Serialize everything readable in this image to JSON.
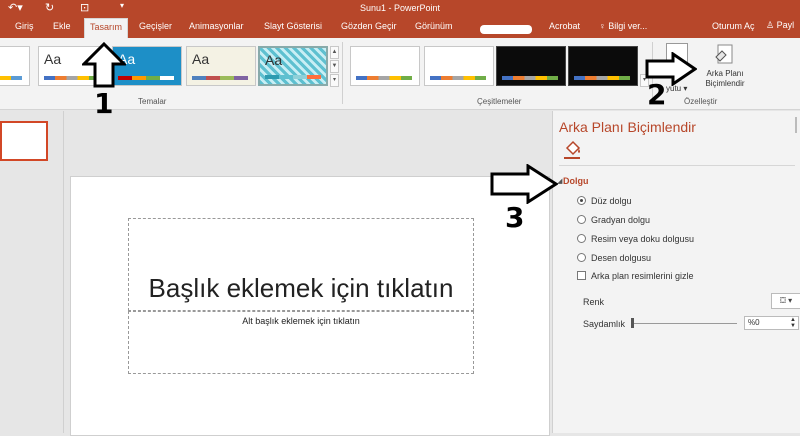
{
  "window": {
    "title": "Sunu1 - PowerPoint"
  },
  "quick_access": {
    "undo_icon": "undo-icon",
    "redo_icon": "redo-icon",
    "start_icon": "start-from-beginning-icon"
  },
  "tabs": [
    {
      "label": "Giriş"
    },
    {
      "label": "Ekle"
    },
    {
      "label": "Tasarım",
      "active": true
    },
    {
      "label": "Geçişler"
    },
    {
      "label": "Animasyonlar"
    },
    {
      "label": "Slayt Gösterisi"
    },
    {
      "label": "Gözden Geçir"
    },
    {
      "label": "Görünüm"
    },
    {
      "label": "Acrobat"
    },
    {
      "label": "Bilgi ver..."
    }
  ],
  "account": {
    "signin": "Oturum Aç",
    "share": "Payl"
  },
  "ribbon": {
    "themes_group": "Temalar",
    "variants_group": "Çeşitlemeler",
    "customize_group": "Özelleştir",
    "theme_thumb_text": "Aa",
    "slide_size_label": "yutu",
    "format_bg_label_line1": "Arka Planı",
    "format_bg_label_line2": "Biçimlendir"
  },
  "slide": {
    "title_placeholder": "Başlık eklemek için tıklatın",
    "subtitle_placeholder": "Alt başlık eklemek için tıklatın"
  },
  "pane": {
    "title": "Arka Planı Biçimlendir",
    "section": "Dolgu",
    "options": [
      {
        "label": "Düz dolgu",
        "selected": true
      },
      {
        "label": "Gradyan dolgu",
        "selected": false
      },
      {
        "label": "Resim veya doku dolgusu",
        "selected": false
      },
      {
        "label": "Desen dolgusu",
        "selected": false
      }
    ],
    "hide_graphics": "Arka plan resimlerini gizle",
    "color_label": "Renk",
    "transparency_label": "Saydamlık",
    "transparency_value": "%0",
    "transparency_level": 0
  },
  "annotations": {
    "n1": "1",
    "n2": "2",
    "n3": "3"
  },
  "colors": {
    "accent": "#b7472a",
    "ribbon": "#f3f3f3"
  }
}
